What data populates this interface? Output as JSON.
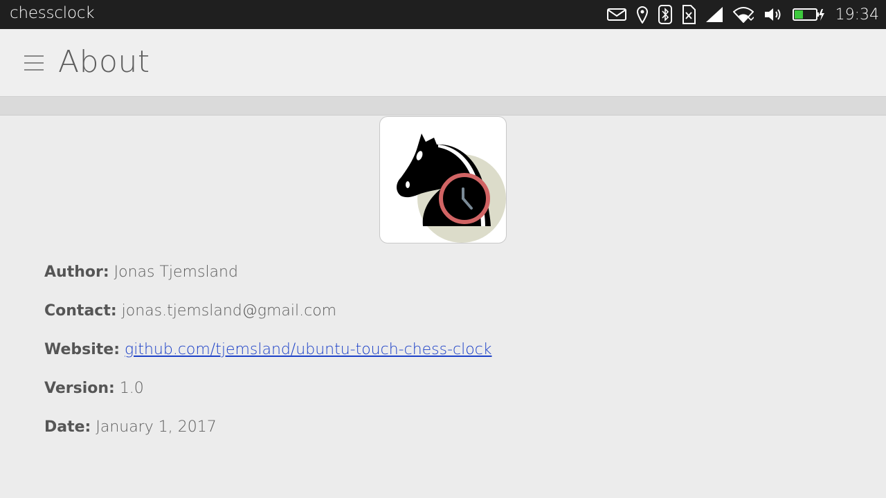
{
  "status_bar": {
    "app_name": "chessclock",
    "time": "19:34",
    "icons": [
      "message-icon",
      "location-icon",
      "bluetooth-icon",
      "sim-card-icon",
      "signal-icon",
      "wifi-icon",
      "volume-icon",
      "battery-icon"
    ],
    "battery_level": 0.4,
    "battery_color": "#3ec93e"
  },
  "header": {
    "title": "About"
  },
  "app_icon": {
    "accent_clock": "#d16464",
    "circle_bg": "#dcdcca"
  },
  "about": {
    "author_label": "Author:",
    "author_value": "Jonas Tjemsland",
    "contact_label": "Contact:",
    "contact_value": "jonas.tjemsland@gmail.com",
    "website_label": "Website:",
    "website_value": "github.com/tjemsland/ubuntu-touch-chess-clock",
    "version_label": "Version:",
    "version_value": "1.0",
    "date_label": "Date:",
    "date_value": "January 1, 2017"
  },
  "colors": {
    "link": "#1a3fc7",
    "status_bar_bg": "#1f1f1f",
    "page_bg": "#ececec"
  }
}
